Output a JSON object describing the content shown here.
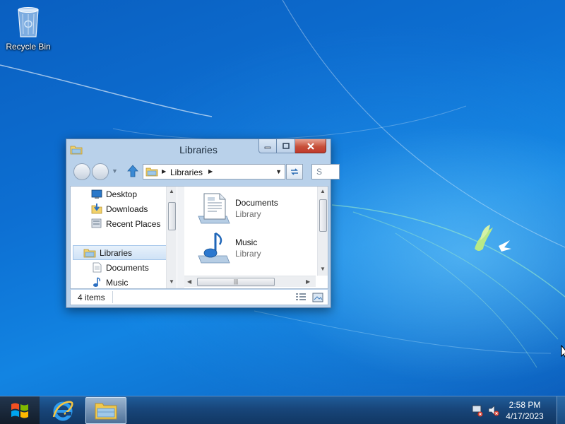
{
  "desktop": {
    "icons": [
      {
        "label": "Recycle Bin",
        "icon": "recycle-bin-icon"
      }
    ]
  },
  "window": {
    "title": "Libraries",
    "caption_buttons": [
      "minimize",
      "maximize",
      "close"
    ],
    "address": {
      "breadcrumb": "Libraries",
      "search_placeholder": "S"
    },
    "nav_pane": {
      "items": [
        {
          "label": "Desktop",
          "icon": "desktop-icon"
        },
        {
          "label": "Downloads",
          "icon": "downloads-icon"
        },
        {
          "label": "Recent Places",
          "icon": "recent-places-icon"
        },
        {
          "label": "Libraries",
          "icon": "libraries-icon",
          "selected": true
        },
        {
          "label": "Documents",
          "icon": "documents-icon"
        },
        {
          "label": "Music",
          "icon": "music-icon"
        }
      ]
    },
    "file_pane": {
      "items": [
        {
          "name": "Documents",
          "type": "Library",
          "icon": "documents-library-icon"
        },
        {
          "name": "Music",
          "type": "Library",
          "icon": "music-library-icon"
        }
      ]
    },
    "status": {
      "item_count": "4 items"
    }
  },
  "taskbar": {
    "pinned": [
      "windows-start-icon",
      "internet-explorer-icon",
      "file-explorer-icon"
    ],
    "tray_icons": [
      "network-icon",
      "volume-muted-icon"
    ],
    "clock": {
      "time": "2:58 PM",
      "date": "4/17/2023"
    }
  },
  "colors": {
    "accent": "#1583e0",
    "window_frame": "#b9d1ea",
    "close_button": "#c7503a",
    "taskbar": "#18467a"
  }
}
